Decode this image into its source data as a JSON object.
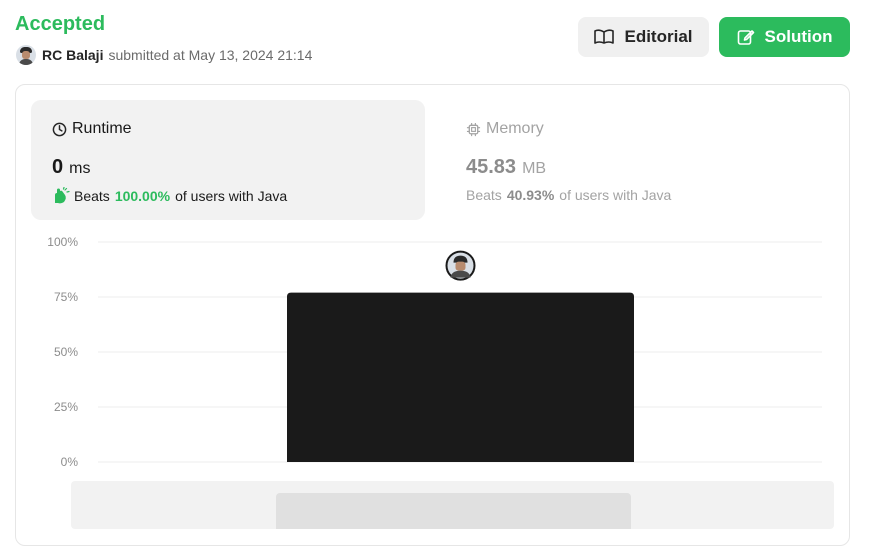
{
  "header": {
    "status": "Accepted",
    "username": "RC Balaji",
    "submitted_text": "submitted at May 13, 2024 21:14"
  },
  "buttons": {
    "editorial_label": "Editorial",
    "solution_label": "Solution"
  },
  "runtime": {
    "title": "Runtime",
    "value": "0",
    "unit": "ms",
    "beats_prefix": "Beats",
    "beats_percent": "100.00%",
    "beats_suffix": "of users with Java"
  },
  "memory": {
    "title": "Memory",
    "value": "45.83",
    "unit": "MB",
    "beats_prefix": "Beats",
    "beats_percent": "40.93%",
    "beats_suffix": "of users with Java"
  },
  "colors": {
    "accent_green": "#2cbb5d",
    "bar": "#1a1a1a"
  },
  "chart_data": {
    "type": "bar",
    "yticks": [
      "100%",
      "75%",
      "50%",
      "25%",
      "0%"
    ],
    "ylim": [
      0,
      100
    ],
    "values": [
      77
    ],
    "marker": "user-avatar"
  }
}
